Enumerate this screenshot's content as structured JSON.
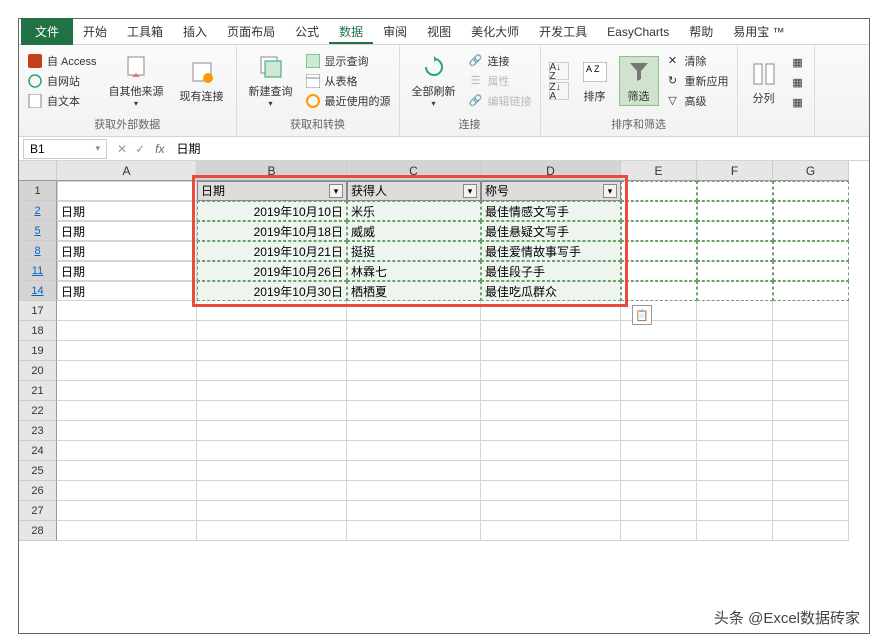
{
  "ribbon": {
    "tabs": [
      "文件",
      "开始",
      "工具箱",
      "插入",
      "页面布局",
      "公式",
      "数据",
      "审阅",
      "视图",
      "美化大师",
      "开发工具",
      "EasyCharts",
      "帮助",
      "易用宝 ™"
    ],
    "active_tab": "数据",
    "groups": {
      "ext_data": {
        "access": "自 Access",
        "web": "自网站",
        "text": "自文本",
        "other": "自其他来源",
        "existing": "现有连接",
        "label": "获取外部数据"
      },
      "get_transform": {
        "new_query": "新建查询",
        "show_query": "显示查询",
        "from_table": "从表格",
        "recent": "最近使用的源",
        "label": "获取和转换"
      },
      "connections": {
        "refresh_all": "全部刷新",
        "conn": "连接",
        "props": "属性",
        "edit_links": "编辑链接",
        "label": "连接"
      },
      "sort_filter": {
        "sort": "排序",
        "filter": "筛选",
        "clear": "清除",
        "reapply": "重新应用",
        "advanced": "高级",
        "label": "排序和筛选"
      },
      "data_tools": {
        "text_to_col": "分列"
      }
    }
  },
  "namebox": "B1",
  "formula": "日期",
  "columns": [
    "A",
    "B",
    "C",
    "D",
    "E",
    "F",
    "G"
  ],
  "visible_rows": [
    "1",
    "2",
    "5",
    "8",
    "11",
    "14",
    "17",
    "18",
    "19",
    "20",
    "21",
    "22",
    "23",
    "24",
    "25",
    "26",
    "27",
    "28"
  ],
  "col_a_label": "日期",
  "table": {
    "headers": [
      "日期",
      "获得人",
      "称号"
    ],
    "rows": [
      {
        "date": "2019年10月10日",
        "person": "米乐",
        "title": "最佳情感文写手"
      },
      {
        "date": "2019年10月18日",
        "person": "威威",
        "title": "最佳悬疑文写手"
      },
      {
        "date": "2019年10月21日",
        "person": "挺挺",
        "title": "最佳爱情故事写手"
      },
      {
        "date": "2019年10月26日",
        "person": "林霖七",
        "title": "最佳段子手"
      },
      {
        "date": "2019年10月30日",
        "person": "栖栖夏",
        "title": "最佳吃瓜群众"
      }
    ]
  },
  "footer": "头条 @Excel数据砖家"
}
